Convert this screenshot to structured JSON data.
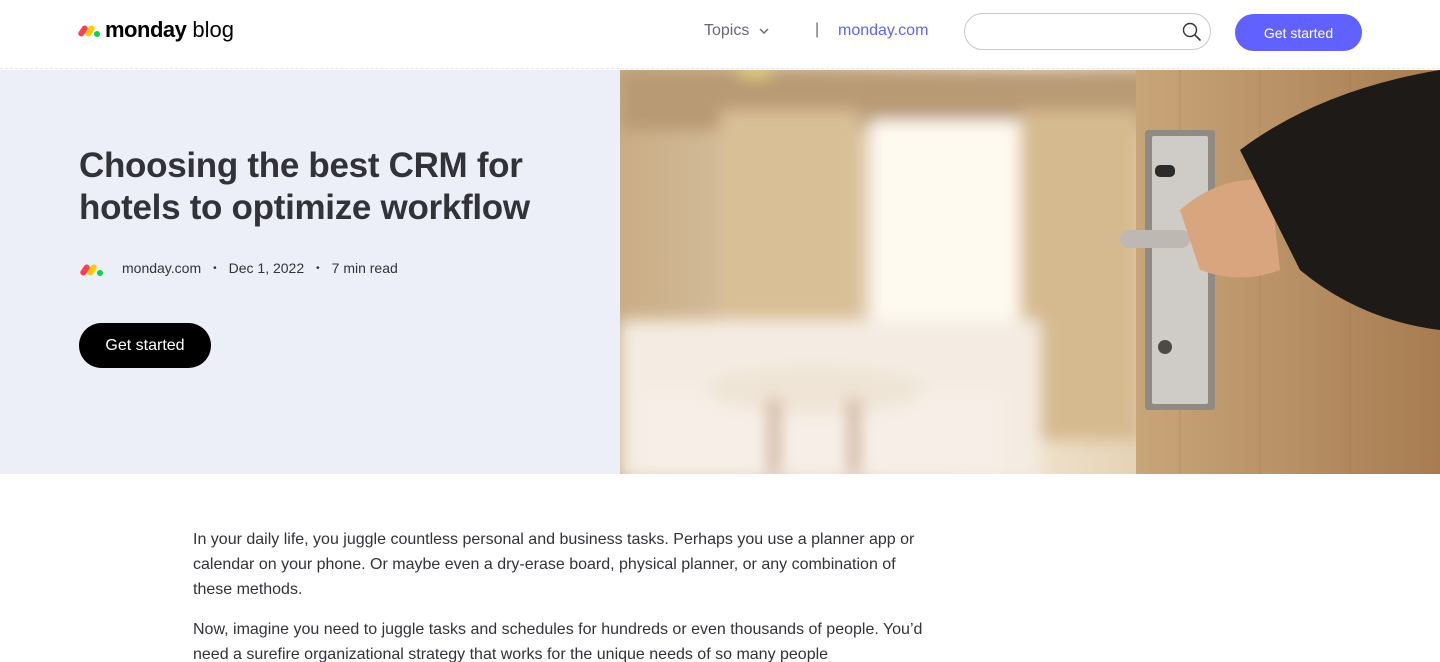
{
  "header": {
    "logo_word": "monday",
    "logo_sub": "blog",
    "topics_label": "Topics",
    "separator": "|",
    "site_link": "monday.com",
    "search_placeholder": "",
    "cta_label": "Get started"
  },
  "hero": {
    "title": "Choosing the best CRM for hotels to optimize workflow",
    "author": "monday.com",
    "date": "Dec 1, 2022",
    "read_time": "7 min read",
    "cta_label": "Get started",
    "image_alt": "Hotel room door being opened"
  },
  "article": {
    "paragraphs": [
      "In your daily life, you juggle countless personal and business tasks. Perhaps you use a planner app or calendar on your phone. Or maybe even a dry-erase board, physical planner, or any combination of these methods.",
      "Now, imagine you need to juggle tasks and schedules for hundreds or even thousands of people. You’d need a surefire organizational strategy that works for the unique needs of so many people"
    ]
  },
  "colors": {
    "brand_red": "#ff3d57",
    "brand_yellow": "#ffcb00",
    "brand_green": "#00d647",
    "accent": "#6161ff",
    "hero_bg": "#eceff8"
  }
}
